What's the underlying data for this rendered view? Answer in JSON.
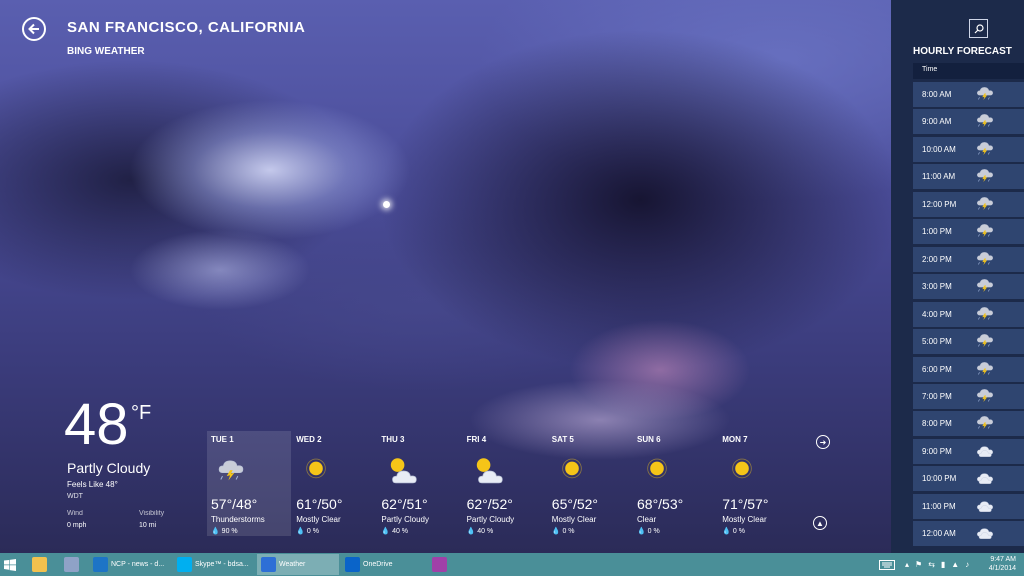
{
  "header": {
    "city": "SAN FRANCISCO, CALIFORNIA",
    "provider": "BING WEATHER"
  },
  "current": {
    "temp": "48",
    "unit": "°F",
    "condition": "Partly Cloudy",
    "feels_like": "Feels Like 48°",
    "station": "WDT",
    "wind_label": "Wind",
    "wind_value": "0 mph",
    "visibility_label": "Visibility",
    "visibility_value": "10 mi"
  },
  "forecast": [
    {
      "day": "TUE 1",
      "temps": "57°/48°",
      "condition": "Thunderstorms",
      "precip": "90 %",
      "icon": "thunderstorm-icon"
    },
    {
      "day": "WED 2",
      "temps": "61°/50°",
      "condition": "Mostly Clear",
      "precip": "0 %",
      "icon": "sun-icon"
    },
    {
      "day": "THU 3",
      "temps": "62°/51°",
      "condition": "Partly Cloudy",
      "precip": "40 %",
      "icon": "partly-cloudy-icon"
    },
    {
      "day": "FRI 4",
      "temps": "62°/52°",
      "condition": "Partly Cloudy",
      "precip": "40 %",
      "icon": "partly-cloudy-icon"
    },
    {
      "day": "SAT 5",
      "temps": "65°/52°",
      "condition": "Mostly Clear",
      "precip": "0 %",
      "icon": "sun-icon"
    },
    {
      "day": "SUN 6",
      "temps": "68°/53°",
      "condition": "Clear",
      "precip": "0 %",
      "icon": "sun-icon"
    },
    {
      "day": "MON 7",
      "temps": "71°/57°",
      "condition": "Mostly Clear",
      "precip": "0 %",
      "icon": "sun-icon"
    }
  ],
  "hourly": {
    "title": "HOURLY FORECAST",
    "column": "Time",
    "rows": [
      {
        "time": "8:00 AM",
        "icon": "thunderstorm-icon"
      },
      {
        "time": "9:00 AM",
        "icon": "thunderstorm-icon"
      },
      {
        "time": "10:00 AM",
        "icon": "thunderstorm-icon"
      },
      {
        "time": "11:00 AM",
        "icon": "thunderstorm-icon"
      },
      {
        "time": "12:00 PM",
        "icon": "thunderstorm-icon"
      },
      {
        "time": "1:00 PM",
        "icon": "thunderstorm-icon"
      },
      {
        "time": "2:00 PM",
        "icon": "thunderstorm-icon"
      },
      {
        "time": "3:00 PM",
        "icon": "thunderstorm-icon"
      },
      {
        "time": "4:00 PM",
        "icon": "thunderstorm-icon"
      },
      {
        "time": "5:00 PM",
        "icon": "thunderstorm-icon"
      },
      {
        "time": "6:00 PM",
        "icon": "thunderstorm-icon"
      },
      {
        "time": "7:00 PM",
        "icon": "thunderstorm-icon"
      },
      {
        "time": "8:00 PM",
        "icon": "thunderstorm-icon"
      },
      {
        "time": "9:00 PM",
        "icon": "cloudy-icon"
      },
      {
        "time": "10:00 PM",
        "icon": "cloudy-icon"
      },
      {
        "time": "11:00 PM",
        "icon": "cloudy-icon"
      },
      {
        "time": "12:00 AM",
        "icon": "cloudy-icon"
      }
    ]
  },
  "taskbar": {
    "items": [
      {
        "label": "",
        "icon": "file-explorer-icon"
      },
      {
        "label": "",
        "icon": "app-icon"
      },
      {
        "label": "NCP - news - d...",
        "icon": "internet-explorer-icon"
      },
      {
        "label": "Skype™ - bdsa...",
        "icon": "skype-icon"
      },
      {
        "label": "Weather",
        "icon": "weather-icon"
      },
      {
        "label": "OneDrive",
        "icon": "onedrive-icon"
      },
      {
        "label": "",
        "icon": "onenote-icon"
      }
    ],
    "time": "9:47 AM",
    "date": "4/1/2014"
  },
  "colors": {
    "taskbar": "#4a8f98",
    "hourly_panel": "#1c2a4a",
    "hourly_row": "#2f4570",
    "sun": "#f5c518"
  }
}
